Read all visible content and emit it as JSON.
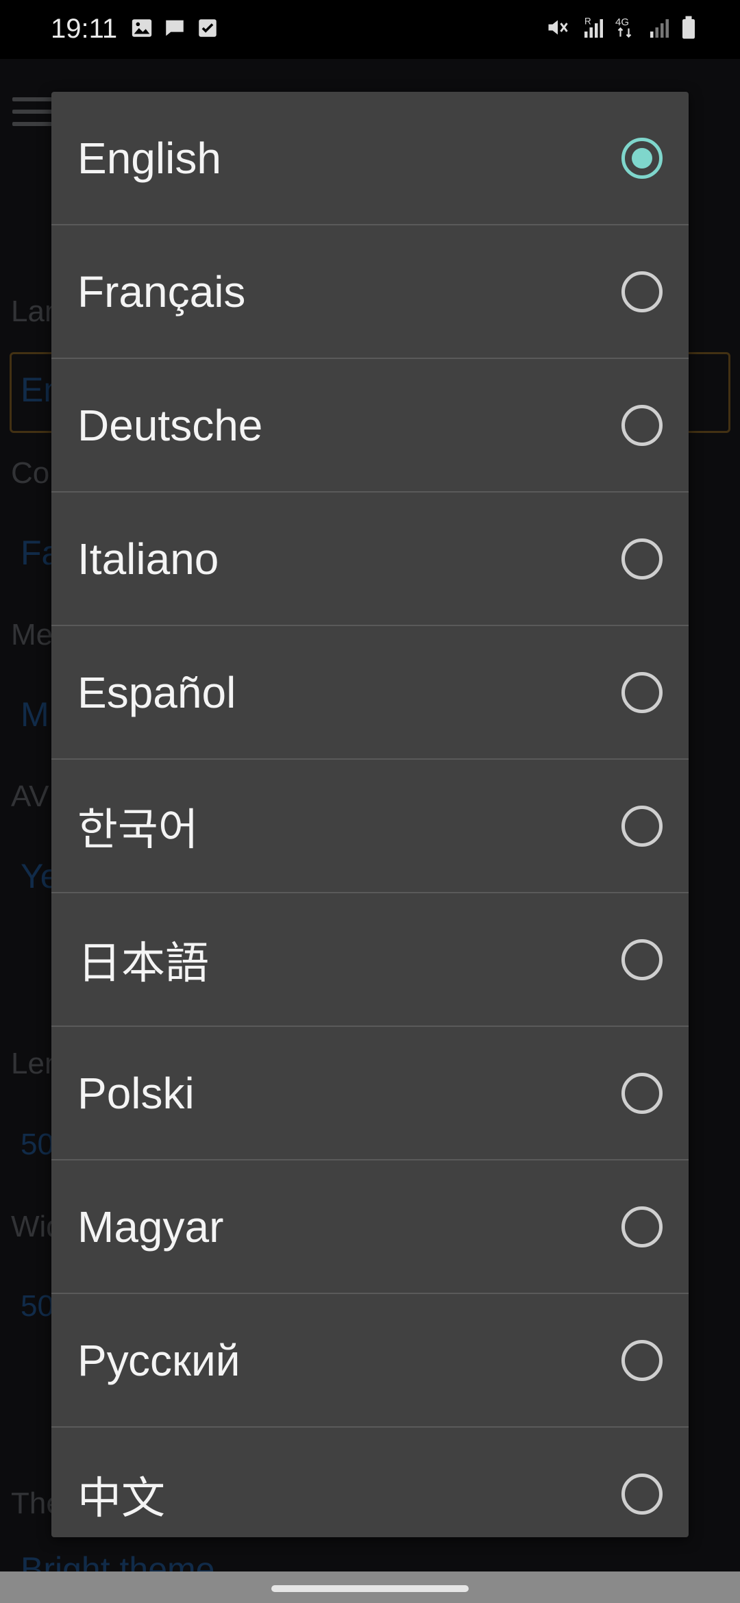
{
  "status_bar": {
    "time": "19:11",
    "left_icons": [
      "image-icon",
      "message-icon",
      "checkbox-icon"
    ],
    "right_icons": [
      "mute-icon",
      "signal-r-icon",
      "4g-icon",
      "signal-icon",
      "battery-icon"
    ]
  },
  "background": {
    "labels": [
      "Lan",
      "Co",
      "Me",
      "AV",
      "Len",
      "Wid",
      "The"
    ],
    "values": [
      "En",
      "Fa",
      "M",
      "Ye",
      "50",
      "50",
      "Bright theme"
    ]
  },
  "language_dialog": {
    "selected": "English",
    "options": [
      {
        "label": "English",
        "checked": true
      },
      {
        "label": "Français",
        "checked": false
      },
      {
        "label": "Deutsche",
        "checked": false
      },
      {
        "label": "Italiano",
        "checked": false
      },
      {
        "label": "Español",
        "checked": false
      },
      {
        "label": "한국어",
        "checked": false
      },
      {
        "label": "日本語",
        "checked": false
      },
      {
        "label": "Polski",
        "checked": false
      },
      {
        "label": "Magyar",
        "checked": false
      },
      {
        "label": "Русский",
        "checked": false
      },
      {
        "label": "中文",
        "checked": false
      }
    ]
  },
  "colors": {
    "accent": "#7fd6cc",
    "dialog_bg": "#414141",
    "field_border": "#7a5a24",
    "bg_value_text": "#1f4f86"
  }
}
